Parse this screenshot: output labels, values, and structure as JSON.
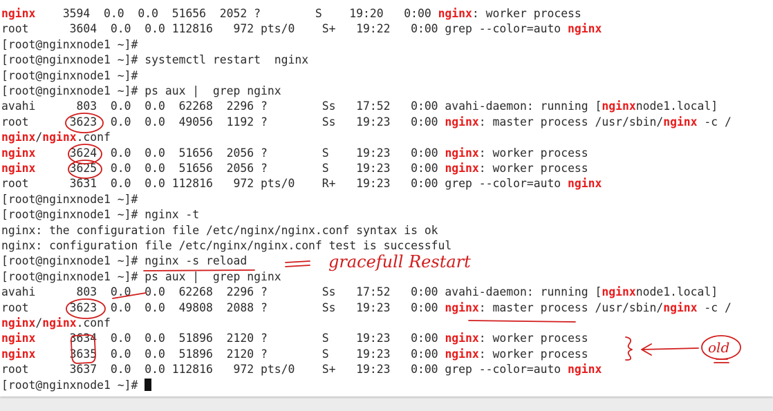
{
  "terminal": {
    "colors": {
      "highlight": "#e81b1b",
      "text": "#2b2b2b",
      "annotation": "#d21c1c"
    },
    "prompt_cursor": "block-cursor",
    "lines": [
      [
        {
          "t": "nginx",
          "h": true
        },
        {
          "t": "    3594  0.0  0.0  51656  2052 ?        S    19:20   0:00 "
        },
        {
          "t": "nginx",
          "h": true
        },
        {
          "t": ": worker process"
        }
      ],
      [
        {
          "t": "root      3604  0.0  0.0 112816   972 pts/0    S+   19:22   0:00 grep --color=auto "
        },
        {
          "t": "nginx",
          "h": true
        }
      ],
      [
        {
          "t": "[root@nginxnode1 ~]#"
        }
      ],
      [
        {
          "t": "[root@nginxnode1 ~]# systemctl restart  nginx"
        }
      ],
      [
        {
          "t": "[root@nginxnode1 ~]#"
        }
      ],
      [
        {
          "t": "[root@nginxnode1 ~]# ps aux |  grep nginx"
        }
      ],
      [
        {
          "t": "avahi      803  0.0  0.0  62268  2296 ?        Ss   17:52   0:00 avahi-daemon: running ["
        },
        {
          "t": "nginx",
          "h": true
        },
        {
          "t": "node1.local]"
        }
      ],
      [
        {
          "t": "root      3623  0.0  0.0  49056  1192 ?        Ss   19:23   0:00 "
        },
        {
          "t": "nginx",
          "h": true
        },
        {
          "t": ": master process /usr/sbin/"
        },
        {
          "t": "nginx",
          "h": true
        },
        {
          "t": " -c /"
        }
      ],
      [
        {
          "t": "nginx",
          "h": true
        },
        {
          "t": "/"
        },
        {
          "t": "nginx",
          "h": true
        },
        {
          "t": ".conf"
        }
      ],
      [
        {
          "t": "nginx",
          "h": true
        },
        {
          "t": "     3624  0.0  0.0  51656  2056 ?        S    19:23   0:00 "
        },
        {
          "t": "nginx",
          "h": true
        },
        {
          "t": ": worker process"
        }
      ],
      [
        {
          "t": "nginx",
          "h": true
        },
        {
          "t": "     3625  0.0  0.0  51656  2056 ?        S    19:23   0:00 "
        },
        {
          "t": "nginx",
          "h": true
        },
        {
          "t": ": worker process"
        }
      ],
      [
        {
          "t": "root      3631  0.0  0.0 112816   972 pts/0    R+   19:23   0:00 grep --color=auto "
        },
        {
          "t": "nginx",
          "h": true
        }
      ],
      [
        {
          "t": "[root@nginxnode1 ~]#"
        }
      ],
      [
        {
          "t": "[root@nginxnode1 ~]# nginx -t"
        }
      ],
      [
        {
          "t": "nginx: the configuration file /etc/nginx/nginx.conf syntax is ok"
        }
      ],
      [
        {
          "t": "nginx: configuration file /etc/nginx/nginx.conf test is successful"
        }
      ],
      [
        {
          "t": "[root@nginxnode1 ~]# nginx -s reload"
        }
      ],
      [
        {
          "t": "[root@nginxnode1 ~]# ps aux |  grep nginx"
        }
      ],
      [
        {
          "t": "avahi      803  0.0  0.0  62268  2296 ?        Ss   17:52   0:00 avahi-daemon: running ["
        },
        {
          "t": "nginx",
          "h": true
        },
        {
          "t": "node1.local]"
        }
      ],
      [
        {
          "t": "root      3623  0.0  0.0  49808  2088 ?        Ss   19:23   0:00 "
        },
        {
          "t": "nginx",
          "h": true
        },
        {
          "t": ": master process /usr/sbin/"
        },
        {
          "t": "nginx",
          "h": true
        },
        {
          "t": " -c /"
        }
      ],
      [
        {
          "t": "nginx",
          "h": true
        },
        {
          "t": "/"
        },
        {
          "t": "nginx",
          "h": true
        },
        {
          "t": ".conf"
        }
      ],
      [
        {
          "t": "nginx",
          "h": true
        },
        {
          "t": "     3634  0.0  0.0  51896  2120 ?        S    19:23   0:00 "
        },
        {
          "t": "nginx",
          "h": true
        },
        {
          "t": ": worker process"
        }
      ],
      [
        {
          "t": "nginx",
          "h": true
        },
        {
          "t": "     3635  0.0  0.0  51896  2120 ?        S    19:23   0:00 "
        },
        {
          "t": "nginx",
          "h": true
        },
        {
          "t": ": worker process"
        }
      ],
      [
        {
          "t": "root      3637  0.0  0.0 112816   972 pts/0    S+   19:23   0:00 grep --color=auto "
        },
        {
          "t": "nginx",
          "h": true
        }
      ],
      [
        {
          "t": "[root@nginxnode1 ~]# "
        }
      ]
    ]
  },
  "annotations": {
    "reload_note": "gracefull   Restart",
    "old_note": "old"
  }
}
